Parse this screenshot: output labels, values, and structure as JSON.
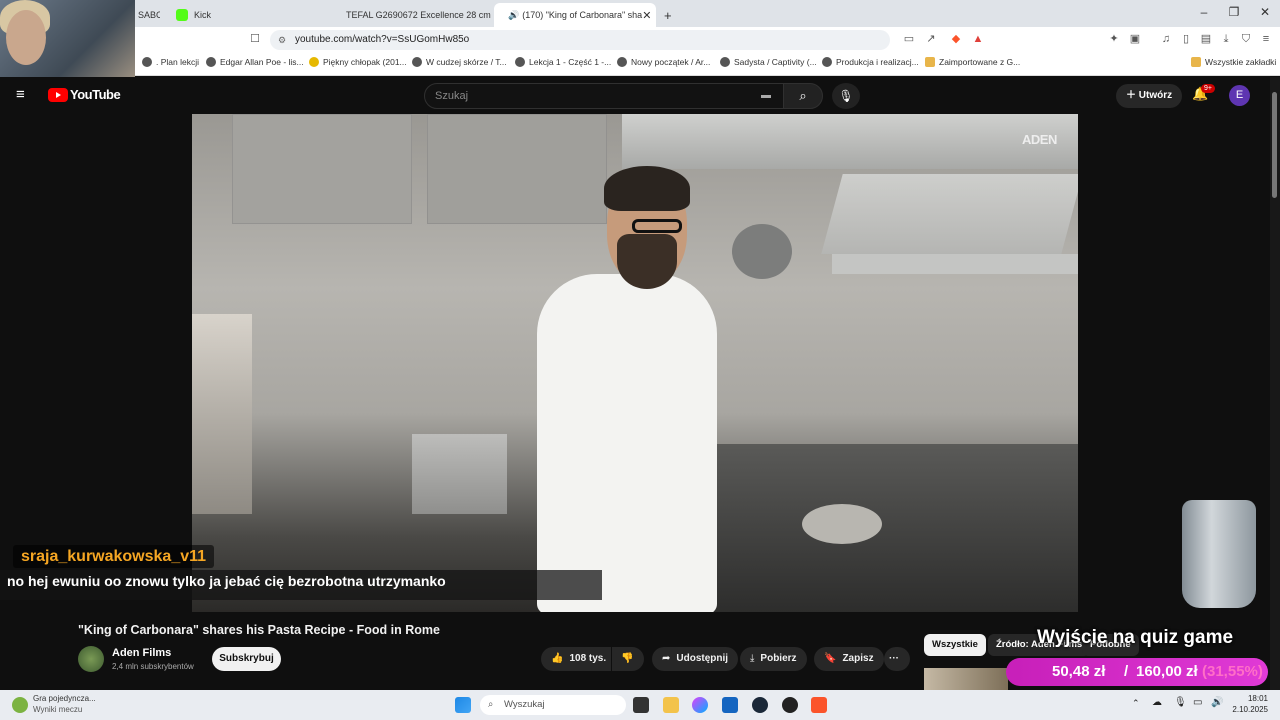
{
  "browser": {
    "tabs": [
      {
        "label": "SABC",
        "icon_color": "#555555"
      },
      {
        "label": "Kick",
        "icon_color": "#53fc18"
      },
      {
        "label": "TEFAL G2690672 Excellence 28 cm Be",
        "icon_color": "#e0c020"
      },
      {
        "label": "(170) \"King of Carbonara\" sha",
        "icon_color": "#ff0000",
        "active": true
      }
    ],
    "new_tab": "+",
    "url": "youtube.com/watch?v=SsUGomHw85o",
    "window_controls": {
      "minimize": "–",
      "maximize": "❐",
      "close": "✕"
    },
    "bookmarks": [
      ". Plan lekcji",
      "Edgar Allan Poe - lis...",
      "Piękny chłopak (201...",
      "W cudzej skórze / T...",
      "Lekcja 1 - Część 1 -...",
      "Nowy początek / Ar...",
      "Sadysta / Captivity (...",
      "Produkcja i realizacj...",
      "Zaimportowane z G..."
    ],
    "all_bookmarks": "Wszystkie zakładki"
  },
  "youtube": {
    "logo": "YouTube",
    "search_placeholder": "Szukaj",
    "create_label": "Utwórz",
    "notification_badge": "9+",
    "avatar_letter": "E",
    "brand_color": "#ff0000"
  },
  "video": {
    "watermark": "ADEN",
    "chat_user": "sraja_kurwakowska_v11",
    "chat_message": "no hej ewuniu oo znowu tylko ja jebać cię bezrobotna utrzymanko"
  },
  "info": {
    "title": "\"King of Carbonara\" shares his Pasta Recipe - Food in Rome",
    "channel": "Aden Films",
    "subscribers": "2,4 mln subskrybentów",
    "subscribe_label": "Subskrybuj",
    "likes": "108 tys.",
    "share_label": "Udostępnij",
    "download_label": "Pobierz",
    "save_label": "Zapisz",
    "more_label": "···"
  },
  "sidebar": {
    "filters": [
      "Wszystkie",
      "Źródło: Aden Films",
      "Podobne"
    ]
  },
  "overlay": {
    "quiz_label": "Wyjście na quiz game",
    "price1": "50,48 zł",
    "price2": "160,00 zł",
    "percent": "(31,55%)"
  },
  "taskbar": {
    "game_title": "Gra pojedyncza...",
    "game_subtitle": "Wyniki meczu",
    "search_placeholder": "Wyszukaj",
    "time": "18:01",
    "date": "2.10.2025"
  }
}
